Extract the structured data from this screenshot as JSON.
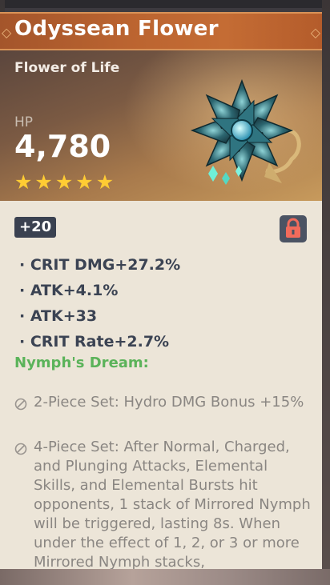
{
  "artifact": {
    "name": "Odyssean Flower",
    "type": "Flower of Life",
    "main_stat": {
      "name": "HP",
      "value": "4,780"
    },
    "rarity_stars": 5,
    "level": "+20",
    "locked": true
  },
  "substats": [
    "· CRIT DMG+27.2%",
    "· ATK+4.1%",
    "· ATK+33",
    "· CRIT Rate+2.7%"
  ],
  "set": {
    "name": "Nymph's Dream:",
    "effects": [
      "2-Piece Set: Hydro DMG Bonus +15%",
      "4-Piece Set: After Normal, Charged, and Plunging Attacks, Elemental Skills, and Elemental Bursts hit opponents, 1 stack of Mirrored Nymph will be triggered, lasting 8s. When under the effect of 1, 2, or 3 or more Mirrored Nymph stacks,"
    ]
  },
  "icons": {
    "star": "star-icon",
    "lock": "lock-icon",
    "inactive": "inactive-set-icon",
    "artifact": "artifact-flower-icon"
  },
  "colors": {
    "title_bar": "#bb6430",
    "set_name": "#5bb35a",
    "star": "#ffcc33",
    "lock": "#f26b5b",
    "panel": "#ece5d8"
  }
}
